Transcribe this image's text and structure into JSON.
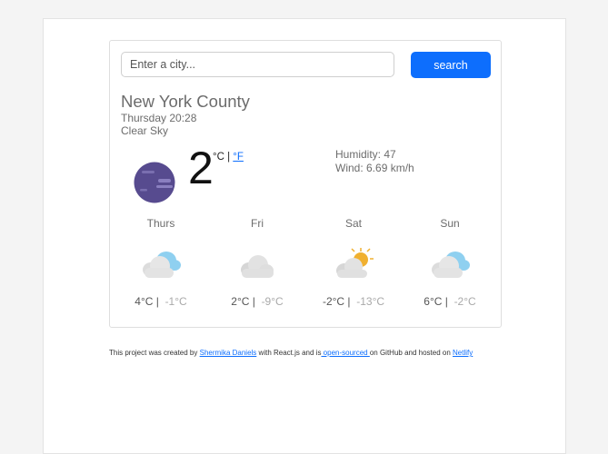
{
  "search": {
    "placeholder": "Enter a city...",
    "button_label": "search"
  },
  "current": {
    "city": "New York County",
    "datetime": "Thursday 20:28",
    "condition": "Clear Sky",
    "icon": "moon-night-icon",
    "temperature": "2",
    "unit_celsius": "°C",
    "unit_separator": " | ",
    "unit_fahrenheit": "°F",
    "humidity_label": "Humidity: 47",
    "wind_label": "Wind: 6.69 km/h"
  },
  "forecast": [
    {
      "day": "Thurs",
      "icon": "cloudy-icon",
      "max": "4°C |",
      "min": "-1°C"
    },
    {
      "day": "Fri",
      "icon": "cloud-icon",
      "max": "2°C |",
      "min": "-9°C"
    },
    {
      "day": "Sat",
      "icon": "partly-sunny-icon",
      "max": "-2°C |",
      "min": "-13°C"
    },
    {
      "day": "Sun",
      "icon": "cloudy-icon",
      "max": "6°C |",
      "min": "-2°C"
    }
  ],
  "footer": {
    "prefix": "This project was created by ",
    "author_link": "Shermika Daniels",
    "middle": " with React.js and is",
    "source_link": " open-sourced ",
    "after_source": "on GitHub and hosted on ",
    "host_link": "Netlify"
  },
  "colors": {
    "accent": "#0d6efd",
    "moon": "#574b8f"
  }
}
